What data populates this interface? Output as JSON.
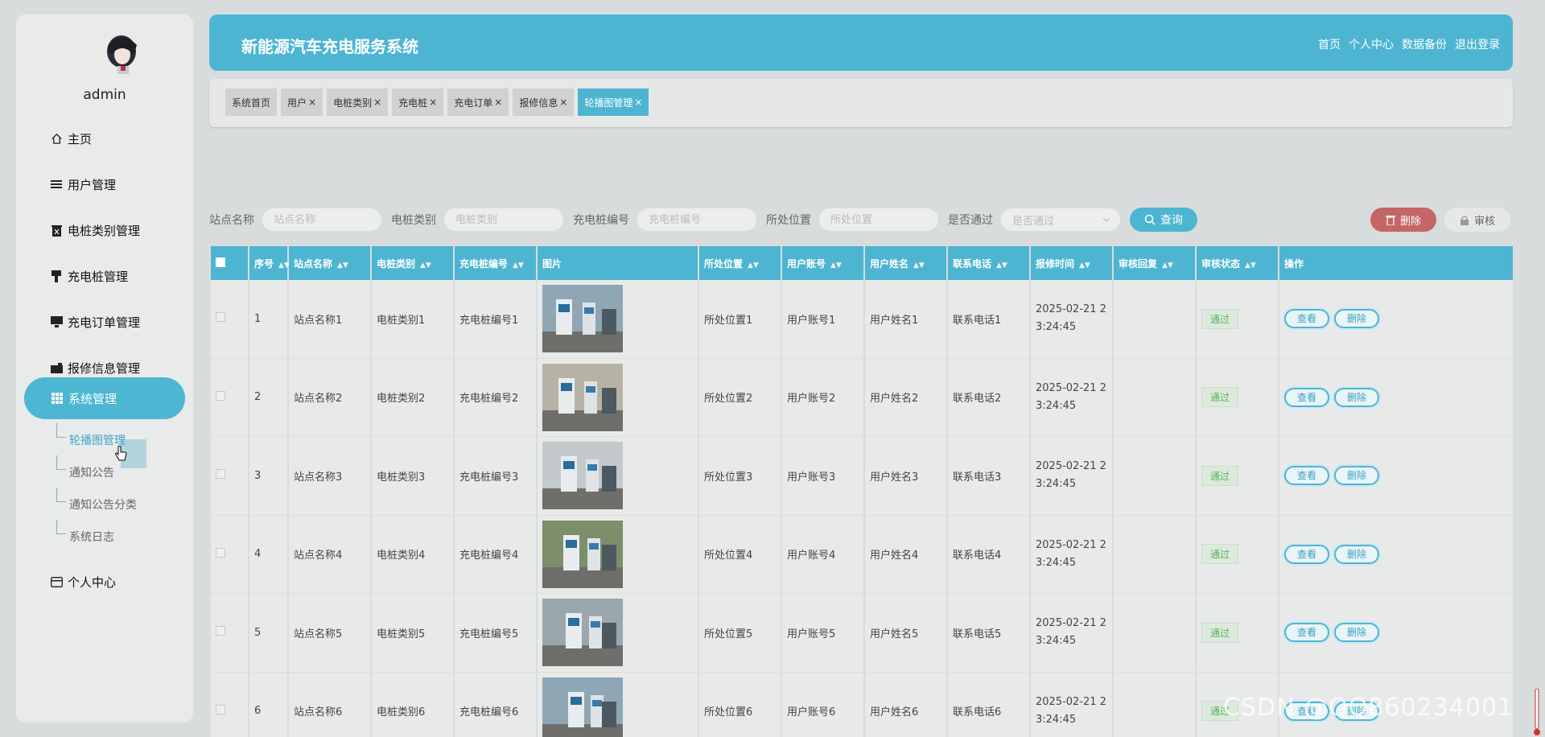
{
  "user": {
    "name": "admin"
  },
  "sidebar": {
    "items": [
      {
        "label": "主页",
        "icon": "home-icon"
      },
      {
        "label": "用户管理",
        "icon": "list-icon"
      },
      {
        "label": "电桩类别管理",
        "icon": "trash-icon"
      },
      {
        "label": "充电桩管理",
        "icon": "plug-icon"
      },
      {
        "label": "充电订单管理",
        "icon": "monitor-icon"
      },
      {
        "label": "报修信息管理",
        "icon": "wallet-icon"
      },
      {
        "label": "系统管理",
        "icon": "grid-icon"
      },
      {
        "label": "个人中心",
        "icon": "card-icon"
      }
    ],
    "submenu": [
      "轮播图管理",
      "通知公告",
      "通知公告分类",
      "系统日志"
    ]
  },
  "header": {
    "title": "新能源汽车充电服务系统",
    "links": [
      "首页",
      "个人中心",
      "数据备份",
      "退出登录"
    ]
  },
  "tabs": [
    {
      "label": "系统首页",
      "closable": false
    },
    {
      "label": "用户",
      "closable": true
    },
    {
      "label": "电桩类别",
      "closable": true
    },
    {
      "label": "充电桩",
      "closable": true
    },
    {
      "label": "充电订单",
      "closable": true
    },
    {
      "label": "报修信息",
      "closable": true
    },
    {
      "label": "轮播图管理",
      "closable": true,
      "active": true
    }
  ],
  "search": {
    "fields": [
      {
        "label": "站点名称",
        "placeholder": "站点名称"
      },
      {
        "label": "电桩类别",
        "placeholder": "电桩类别"
      },
      {
        "label": "充电桩编号",
        "placeholder": "充电桩编号"
      },
      {
        "label": "所处位置",
        "placeholder": "所处位置"
      }
    ],
    "select": {
      "label": "是否通过",
      "placeholder": "是否通过"
    },
    "query_label": "查询",
    "delete_label": "删除",
    "audit_label": "审核"
  },
  "table": {
    "columns": [
      "序号",
      "站点名称",
      "电桩类别",
      "充电桩编号",
      "图片",
      "所处位置",
      "用户账号",
      "用户姓名",
      "联系电话",
      "报修时间",
      "审核回复",
      "审核状态",
      "操作"
    ],
    "rows": [
      [
        "1",
        "站点名称1",
        "电桩类别1",
        "充电桩编号1",
        "所处位置1",
        "用户账号1",
        "用户姓名1",
        "联系电话1",
        "2025-02-21 2",
        "3:24:45",
        "",
        "通过"
      ],
      [
        "2",
        "站点名称2",
        "电桩类别2",
        "充电桩编号2",
        "所处位置2",
        "用户账号2",
        "用户姓名2",
        "联系电话2",
        "2025-02-21 2",
        "3:24:45",
        "",
        "通过"
      ],
      [
        "3",
        "站点名称3",
        "电桩类别3",
        "充电桩编号3",
        "所处位置3",
        "用户账号3",
        "用户姓名3",
        "联系电话3",
        "2025-02-21 2",
        "3:24:45",
        "",
        "通过"
      ],
      [
        "4",
        "站点名称4",
        "电桩类别4",
        "充电桩编号4",
        "所处位置4",
        "用户账号4",
        "用户姓名4",
        "联系电话4",
        "2025-02-21 2",
        "3:24:45",
        "",
        "通过"
      ],
      [
        "5",
        "站点名称5",
        "电桩类别5",
        "充电桩编号5",
        "所处位置5",
        "用户账号5",
        "用户姓名5",
        "联系电话5",
        "2025-02-21 2",
        "3:24:45",
        "",
        "通过"
      ],
      [
        "6",
        "站点名称6",
        "电桩类别6",
        "充电桩编号6",
        "所处位置6",
        "用户账号6",
        "用户姓名6",
        "联系电话6",
        "2025-02-21 2",
        "3:24:45",
        "",
        "通过"
      ]
    ],
    "view_label": "查看",
    "delete_label": "删除"
  },
  "watermark": "CSDN @QQ860234001",
  "colors": {
    "accent": "#4db5d2",
    "danger": "#c46666",
    "success": "#56b45b"
  }
}
